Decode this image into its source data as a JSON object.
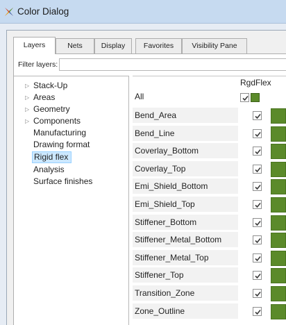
{
  "window": {
    "title": "Color Dialog",
    "icon": "color-dialog-icon"
  },
  "tabs": [
    {
      "label": "Layers",
      "active": true
    },
    {
      "label": "Nets",
      "active": false
    },
    {
      "label": "Display",
      "active": false
    },
    {
      "label": "Favorites",
      "active": false
    },
    {
      "label": "Visibility Pane",
      "active": false
    }
  ],
  "filter": {
    "label": "Filter layers:",
    "value": ""
  },
  "tree": [
    {
      "label": "Stack-Up",
      "expandable": true
    },
    {
      "label": "Areas",
      "expandable": true
    },
    {
      "label": "Geometry",
      "expandable": true
    },
    {
      "label": "Components",
      "expandable": true
    },
    {
      "label": "Manufacturing",
      "expandable": false
    },
    {
      "label": "Drawing format",
      "expandable": false
    },
    {
      "label": "Rigid flex",
      "expandable": false,
      "selected": true
    },
    {
      "label": "Analysis",
      "expandable": false
    },
    {
      "label": "Surface finishes",
      "expandable": false
    }
  ],
  "grid": {
    "column_header": "RgdFlex",
    "all_label": "All",
    "all_checked": true,
    "swatch_color": "#5b8a2a",
    "rows": [
      {
        "name": "Bend_Area",
        "checked": true
      },
      {
        "name": "Bend_Line",
        "checked": true
      },
      {
        "name": "Coverlay_Bottom",
        "checked": true
      },
      {
        "name": "Coverlay_Top",
        "checked": true
      },
      {
        "name": "Emi_Shield_Bottom",
        "checked": true
      },
      {
        "name": "Emi_Shield_Top",
        "checked": true
      },
      {
        "name": "Stiffener_Bottom",
        "checked": true
      },
      {
        "name": "Stiffener_Metal_Bottom",
        "checked": true
      },
      {
        "name": "Stiffener_Metal_Top",
        "checked": true
      },
      {
        "name": "Stiffener_Top",
        "checked": true
      },
      {
        "name": "Transition_Zone",
        "checked": true
      },
      {
        "name": "Zone_Outline",
        "checked": true
      }
    ]
  }
}
